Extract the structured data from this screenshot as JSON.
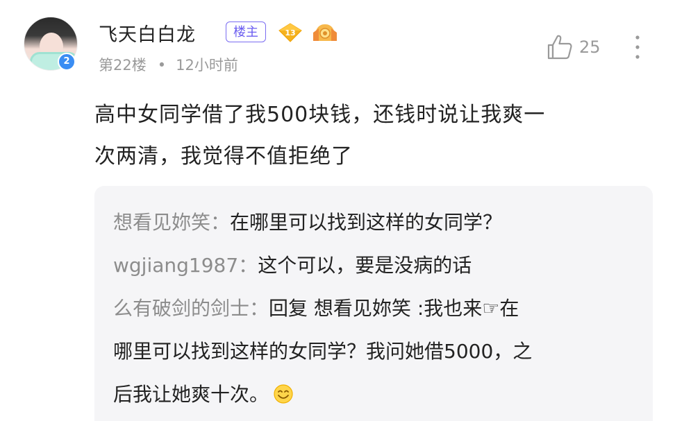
{
  "user": {
    "name": "飞天白白龙",
    "op_badge": "楼主",
    "level": "13",
    "avatar_badge": "2"
  },
  "meta": {
    "floor": "第22楼",
    "separator": "•",
    "time": "12小时前"
  },
  "actions": {
    "like_count": "25"
  },
  "post": {
    "line1": "高中女同学借了我500块钱，还钱时说让我爽一",
    "line2": "次两清，我觉得不值拒绝了"
  },
  "replies": [
    {
      "author": "想看见妳笑",
      "sep": "：",
      "text": "在哪里可以找到这样的女同学？"
    },
    {
      "author": "wgjiang1987",
      "sep": "：",
      "text": "这个可以，要是没病的话"
    },
    {
      "author": "么有破剑的剑士",
      "sep": "：",
      "text_line1": "回复 想看见妳笑 :我也来☞在",
      "text_line2": "哪里可以找到这样的女同学？我问她借5000，之",
      "text_line3": "后我让她爽十次。"
    }
  ],
  "colors": {
    "op_badge": "#6a5cf0",
    "avatar_badge": "#3a8df3",
    "level_badge": "#f5b21f",
    "reply_bg": "#f5f5f7",
    "muted_text": "#9a9a9a"
  },
  "icons": {
    "like": "thumbs-up-icon",
    "more": "more-vertical-icon",
    "level": "level-diamond-icon",
    "medal": "medal-icon",
    "emoji": "smile-emoji-icon"
  }
}
